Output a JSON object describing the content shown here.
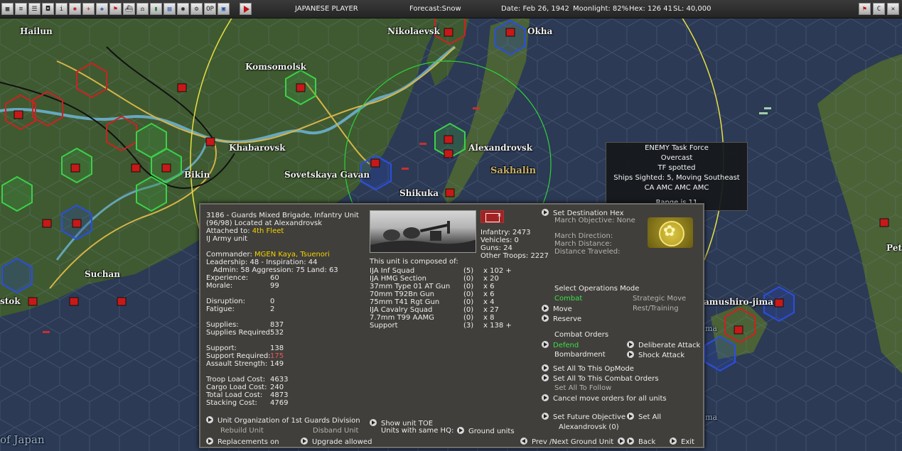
{
  "toolbar": {
    "icons": [
      "airbase-icon",
      "document-icon",
      "list-icon",
      "bus-icon",
      "info-icon",
      "rising-sun-flag-icon",
      "aircraft-icon",
      "plane-blue-icon",
      "flag-icon",
      "ship-icon",
      "balance-icon",
      "bar-chart-icon",
      "map-icon",
      "globe-icon",
      "gear-icon",
      "op-icon",
      "window-icon"
    ],
    "play_icon": "play-icon",
    "player": "JAPANESE PLAYER",
    "forecast": "Forecast:Snow",
    "date": "Date: Feb 26, 1942",
    "moonlight": "Moonlight: 82%",
    "hex": "Hex: 126 41",
    "sl": "SL: 40,000",
    "right_icons": [
      "flag-icon",
      "c-icon",
      "close-icon"
    ]
  },
  "map": {
    "places": [
      "Hailun",
      "Nikolaevsk",
      "Okha",
      "Komsomolsk",
      "Khabarovsk",
      "Alexandrovsk",
      "Sovetskaya Gavan",
      "Bikin",
      "Sakhalin",
      "Shikuka",
      "Suchan",
      "stok",
      "amushiro-jima",
      "of Japan",
      "Petr",
      "ma",
      "ma"
    ],
    "colors": {
      "sea": "#2c3a55",
      "land": "#415a32",
      "river": "#6fb6d8",
      "road": "#d8b448",
      "soviet_hex": "#cc2222",
      "japan_hex": "#2244cc",
      "range_circle": "#e8e040",
      "air_circle": "#2fd23a"
    }
  },
  "tooltip": {
    "lines": [
      "ENEMY Task Force",
      "Overcast",
      "TF spotted",
      "Ships Sighted: 5, Moving Southeast",
      "CA AMC AMC AMC"
    ],
    "range": "Range is 11"
  },
  "unit": {
    "title": "3186 - Guards Mixed Brigade, Infantry Unit",
    "location": "(96/98) Located at  Alexandrovsk",
    "attached_label": "Attached to: ",
    "attached_value": "4th Fleet",
    "army": "IJ Army unit",
    "commander_label": "Commander: ",
    "commander_value": "MGEN Kaya, Tsuenori",
    "leadership": "Leadership: 48 - Inspiration: 44",
    "admin": "Admin: 58  Aggression: 75  Land: 63",
    "stats": [
      {
        "label": "Experience:",
        "value": "60"
      },
      {
        "label": "Morale:",
        "value": "99"
      },
      {
        "label": "Disruption:",
        "value": "0"
      },
      {
        "label": "Fatigue:",
        "value": "2"
      },
      {
        "label": "Supplies:",
        "value": "837"
      },
      {
        "label": "Supplies Required:",
        "value": "532"
      },
      {
        "label": "Support:",
        "value": "138"
      },
      {
        "label": "Support Required:",
        "value": "175"
      },
      {
        "label": "Assault Strength:",
        "value": "149"
      },
      {
        "label": "Troop Load Cost:",
        "value": "4633"
      },
      {
        "label": "Cargo Load Cost:",
        "value": "240"
      },
      {
        "label": "Total Load Cost:",
        "value": "4873"
      },
      {
        "label": "Stacking Cost:",
        "value": "4769"
      }
    ],
    "totals": [
      "Infantry: 2473",
      "Vehicles: 0",
      "Guns: 24",
      "Other Troops: 2227"
    ],
    "composed_title": "This unit is composed of:",
    "composition": [
      {
        "name": "IJA Inf Squad",
        "n": "(5)",
        "q": "x 102 +"
      },
      {
        "name": "IJA HMG Section",
        "n": "(0)",
        "q": "x 20"
      },
      {
        "name": "37mm Type 01 AT Gun",
        "n": "(0)",
        "q": "x 6"
      },
      {
        "name": "70mm T92Bn Gun",
        "n": "(0)",
        "q": "x 6"
      },
      {
        "name": "75mm T41 Rgt Gun",
        "n": "(0)",
        "q": "x 4"
      },
      {
        "name": "IJA Cavalry Squad",
        "n": "(0)",
        "q": "x 27"
      },
      {
        "name": "7.7mm T99 AAMG",
        "n": "(0)",
        "q": "x 8"
      },
      {
        "name": "Support",
        "n": "(3)",
        "q": "x 138 +"
      }
    ],
    "destination": "Set Destination Hex",
    "march_objective": "March Objective: None",
    "march_direction": "March Direction:",
    "march_distance": "March Distance:",
    "distance_traveled": "Distance Traveled:",
    "ops_title": "Select Operations Mode",
    "ops": {
      "combat": "Combat",
      "strategic": "Strategic Move",
      "move": "Move",
      "rest": "Rest/Training",
      "reserve": "Reserve"
    },
    "orders_title": "Combat Orders",
    "orders": {
      "defend": "Defend",
      "deliberate": "Deliberate Attack",
      "bombardment": "Bombardment",
      "shock": "Shock Attack"
    },
    "set_all_opmode": "Set All To This OpMode",
    "set_all_combat": "Set All To This Combat Orders",
    "set_all_follow": "Set All To Follow",
    "cancel_move": "Cancel move orders for all units",
    "future_objective": "Set Future Objective",
    "set_all": "Set All",
    "future_value": "Alexandrovsk (0)",
    "unit_org": "Unit Organization of 1st Guards Division",
    "rebuild": "Rebuild Unit",
    "disband": "Disband Unit",
    "show_toe": "Show unit TOE",
    "same_hq": "Units with same HQ:",
    "ground_units": "Ground units",
    "replacements": "Replacements on",
    "upgrade": "Upgrade allowed",
    "prev_next": "Prev /Next Ground Unit",
    "back": "Back",
    "exit": "Exit"
  }
}
